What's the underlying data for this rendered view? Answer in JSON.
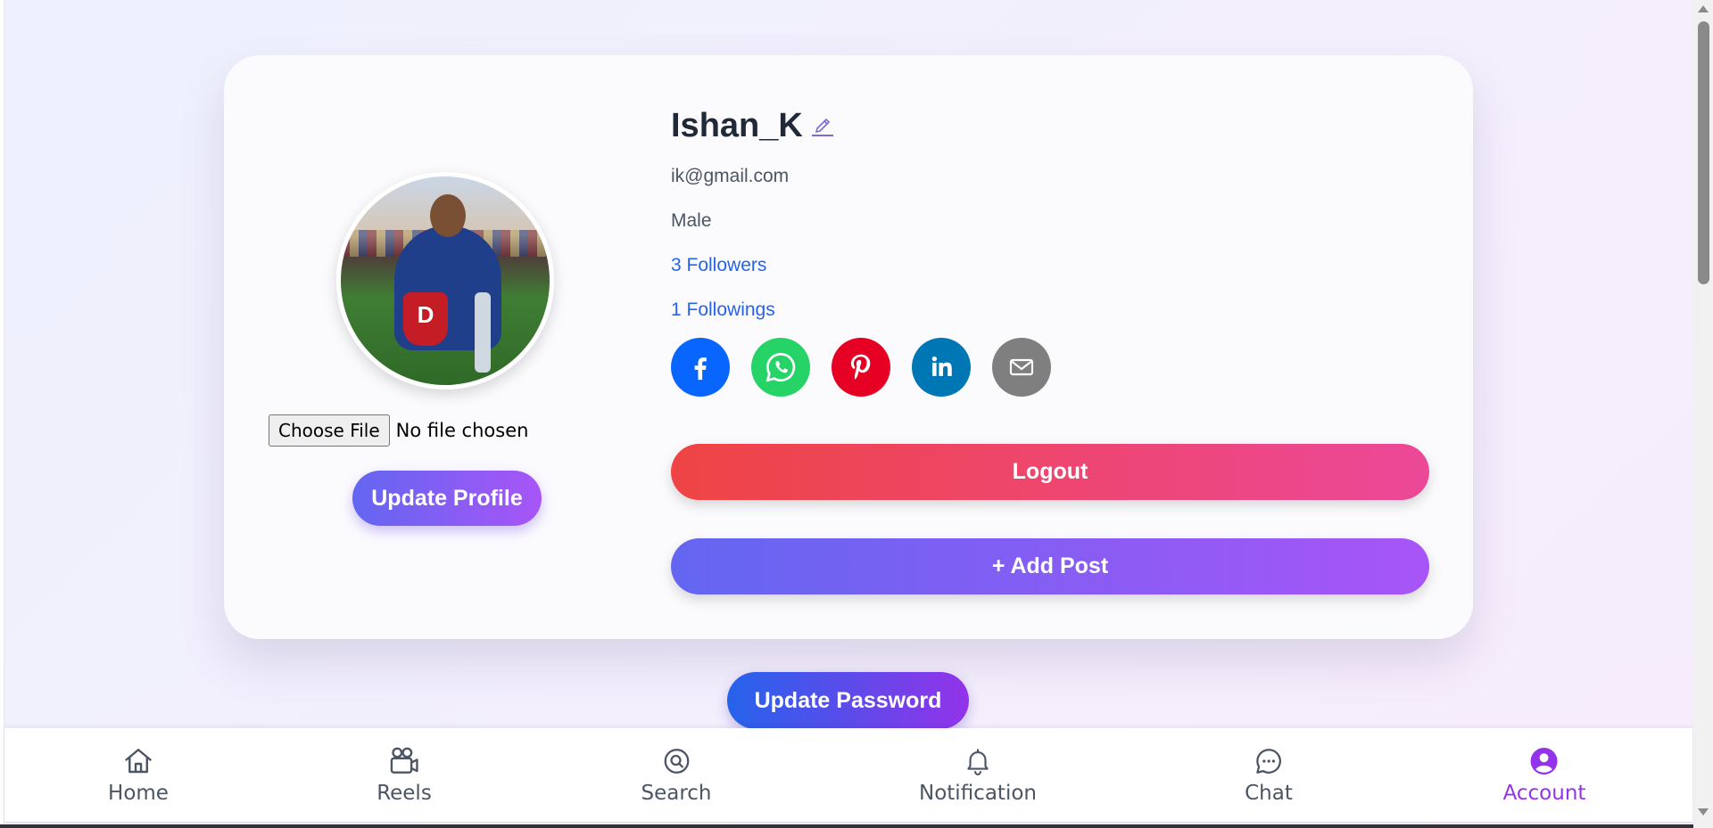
{
  "profile": {
    "username": "Ishan_K",
    "email": "ik@gmail.com",
    "gender": "Male",
    "followers": "3 Followers",
    "followings": "1 Followings",
    "file_button_label": "Choose File",
    "file_status": "No file chosen",
    "update_profile_label": "Update Profile",
    "avatar_trophy_letter": "D"
  },
  "socials": [
    {
      "name": "facebook",
      "icon": "facebook-icon",
      "color": "#0866ff"
    },
    {
      "name": "whatsapp",
      "icon": "whatsapp-icon",
      "color": "#25d366"
    },
    {
      "name": "pinterest",
      "icon": "pinterest-icon",
      "color": "#e60023"
    },
    {
      "name": "linkedin",
      "icon": "linkedin-icon",
      "color": "#0077b5"
    },
    {
      "name": "email",
      "icon": "mail-icon",
      "color": "#7f7f7f"
    }
  ],
  "actions": {
    "logout_label": "Logout",
    "add_post_label": "+ Add Post",
    "update_password_label": "Update Password"
  },
  "nav": {
    "home": "Home",
    "reels": "Reels",
    "search": "Search",
    "notification": "Notification",
    "chat": "Chat",
    "account": "Account",
    "active": "Account"
  },
  "colors": {
    "accent": "#9333ea",
    "link": "#2563eb",
    "logout_start": "#ef4444",
    "logout_end": "#ec4899",
    "primary_start": "#6366f1",
    "primary_end": "#a855f7"
  }
}
